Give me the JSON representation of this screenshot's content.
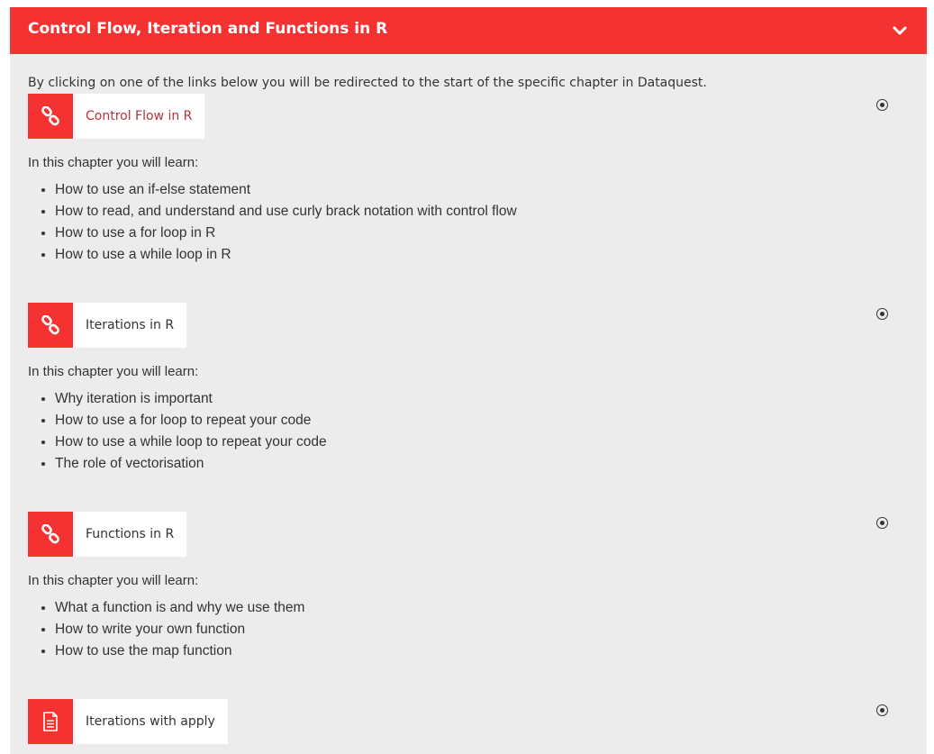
{
  "section": {
    "title": "Control Flow, Iteration and Functions in R",
    "intro": "By clicking on one of the links below you will be redirected to the start of the specific chapter in Dataquest."
  },
  "activities": [
    {
      "label": "Control Flow in R",
      "icon": "link-icon",
      "learn_label": "In this chapter you will learn:",
      "items": [
        "How to use an if-else statement",
        "How to read, and understand and use curly brack notation with control flow",
        "How to use a for loop in R",
        "How to use a while loop in R"
      ]
    },
    {
      "label": "Iterations in R",
      "icon": "link-icon",
      "learn_label": "In this chapter you will learn:",
      "items": [
        "Why iteration is important",
        "How to use a for loop to repeat your code",
        "How to use a while loop to repeat your code",
        "The role of vectorisation"
      ]
    },
    {
      "label": "Functions in R",
      "icon": "link-icon",
      "learn_label": "In this chapter you will learn:",
      "items": [
        "What a function is and why we use them",
        "How to write your own function",
        "How to use the map function"
      ]
    },
    {
      "label": "Iterations with apply",
      "icon": "document-icon"
    }
  ],
  "colors": {
    "accent": "#f53232",
    "background": "#ececec",
    "active_link": "#b5313d"
  }
}
